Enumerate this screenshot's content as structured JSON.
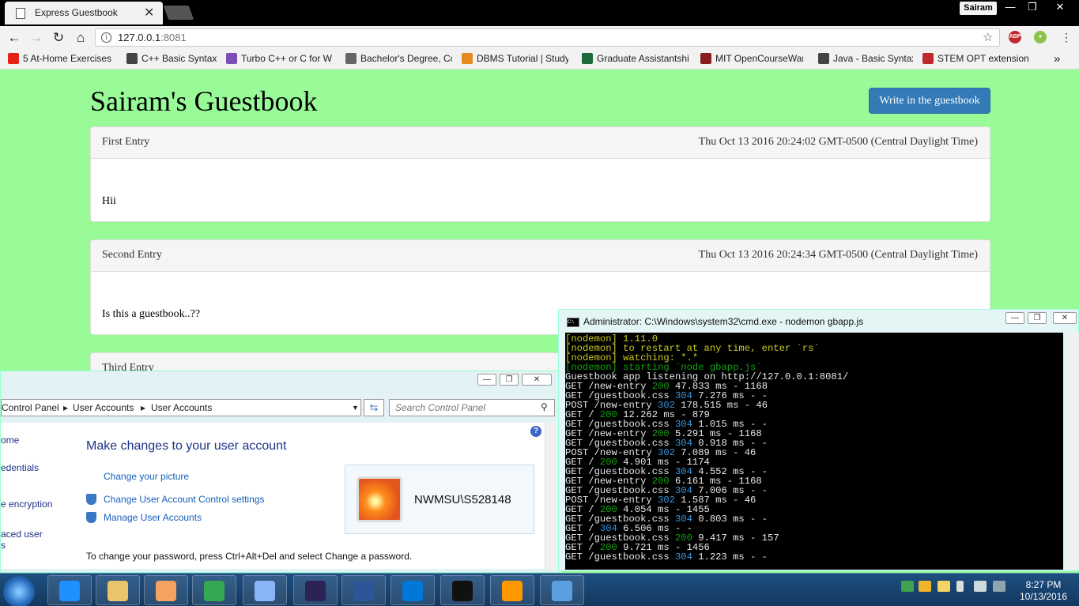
{
  "browser": {
    "tab_title": "Express Guestbook",
    "tab_close": "✕",
    "profile_name": "Sairam",
    "window_controls": [
      "—",
      "❐",
      "✕"
    ],
    "url_host": "127.0.0.1",
    "url_port": ":8081",
    "bookmarks": [
      {
        "label": "5 At-Home Exercises",
        "color": "#e62117"
      },
      {
        "label": "C++ Basic Syntax",
        "color": "#444444"
      },
      {
        "label": "Turbo C++ or C for W",
        "color": "#7a4fb5"
      },
      {
        "label": "Bachelor's Degree, Co",
        "color": "#666666"
      },
      {
        "label": "DBMS Tutorial | Study",
        "color": "#e58a1f"
      },
      {
        "label": "Graduate Assistantshi",
        "color": "#1d6b3a"
      },
      {
        "label": "MIT OpenCourseWare",
        "color": "#8a1c1c"
      },
      {
        "label": "Java - Basic Syntax",
        "color": "#444444"
      },
      {
        "label": "STEM OPT extension",
        "color": "#c0282d"
      }
    ],
    "bookmarks_more": "»",
    "extensions": [
      {
        "label": "ABP",
        "color": "#c1272d"
      },
      {
        "label": "●",
        "color": "#8bc34a"
      }
    ]
  },
  "page": {
    "title": "Sairam's Guestbook",
    "write_button": "Write in the guestbook",
    "entries": [
      {
        "title": "First Entry",
        "date": "Thu Oct 13 2016 20:24:02 GMT-0500 (Central Daylight Time)",
        "body": "Hii"
      },
      {
        "title": "Second Entry",
        "date": "Thu Oct 13 2016 20:24:34 GMT-0500 (Central Daylight Time)",
        "body": "Is this a guestbook..??"
      },
      {
        "title": "Third Entry"
      }
    ]
  },
  "control_panel": {
    "breadcrumb": [
      "Control Panel",
      "User Accounts",
      "User Accounts"
    ],
    "search_placeholder": "Search Control Panel",
    "side_items": [
      "ome",
      "edentials",
      "e encryption",
      "aced user",
      "s"
    ],
    "heading": "Make changes to your user account",
    "links": [
      "Change your picture",
      "Change User Account Control settings",
      "Manage User Accounts"
    ],
    "user_name": "NWMSU\\S528148",
    "footer_text": "To change your password, press Ctrl+Alt+Del and select Change a password."
  },
  "cmd": {
    "title": "Administrator: C:\\Windows\\system32\\cmd.exe - nodemon  gbapp.js",
    "lines": [
      [
        {
          "t": "[nodemon] 1.11.0",
          "c": "y"
        }
      ],
      [
        {
          "t": "[nodemon] to restart at any time, enter `rs`",
          "c": "y"
        }
      ],
      [
        {
          "t": "[nodemon] watching: *.*",
          "c": "y"
        }
      ],
      [
        {
          "t": "[nodemon] starting `node gbapp.js`",
          "c": "gr"
        }
      ],
      [
        {
          "t": "Guestbook app listening on http://127.0.0.1:8081/",
          "c": "w"
        }
      ],
      [
        {
          "t": "GET /new-entry ",
          "c": "w"
        },
        {
          "t": "200",
          "c": "gr"
        },
        {
          "t": " 47.833 ms - 1168",
          "c": "w"
        }
      ],
      [
        {
          "t": "GET /guestbook.css ",
          "c": "w"
        },
        {
          "t": "304",
          "c": "c"
        },
        {
          "t": " 7.276 ms - -",
          "c": "w"
        }
      ],
      [
        {
          "t": "POST /new-entry ",
          "c": "w"
        },
        {
          "t": "302",
          "c": "c"
        },
        {
          "t": " 178.515 ms - 46",
          "c": "w"
        }
      ],
      [
        {
          "t": "GET / ",
          "c": "w"
        },
        {
          "t": "200",
          "c": "gr"
        },
        {
          "t": " 12.262 ms - 879",
          "c": "w"
        }
      ],
      [
        {
          "t": "GET /guestbook.css ",
          "c": "w"
        },
        {
          "t": "304",
          "c": "c"
        },
        {
          "t": " 1.015 ms - -",
          "c": "w"
        }
      ],
      [
        {
          "t": "GET /new-entry ",
          "c": "w"
        },
        {
          "t": "200",
          "c": "gr"
        },
        {
          "t": " 5.291 ms - 1168",
          "c": "w"
        }
      ],
      [
        {
          "t": "GET /guestbook.css ",
          "c": "w"
        },
        {
          "t": "304",
          "c": "c"
        },
        {
          "t": " 0.918 ms - -",
          "c": "w"
        }
      ],
      [
        {
          "t": "POST /new-entry ",
          "c": "w"
        },
        {
          "t": "302",
          "c": "c"
        },
        {
          "t": " 7.089 ms - 46",
          "c": "w"
        }
      ],
      [
        {
          "t": "GET / ",
          "c": "w"
        },
        {
          "t": "200",
          "c": "gr"
        },
        {
          "t": " 4.901 ms - 1174",
          "c": "w"
        }
      ],
      [
        {
          "t": "GET /guestbook.css ",
          "c": "w"
        },
        {
          "t": "304",
          "c": "c"
        },
        {
          "t": " 4.552 ms - -",
          "c": "w"
        }
      ],
      [
        {
          "t": "GET /new-entry ",
          "c": "w"
        },
        {
          "t": "200",
          "c": "gr"
        },
        {
          "t": " 6.161 ms - 1168",
          "c": "w"
        }
      ],
      [
        {
          "t": "GET /guestbook.css ",
          "c": "w"
        },
        {
          "t": "304",
          "c": "c"
        },
        {
          "t": " 7.006 ms - -",
          "c": "w"
        }
      ],
      [
        {
          "t": "POST /new-entry ",
          "c": "w"
        },
        {
          "t": "302",
          "c": "c"
        },
        {
          "t": " 1.587 ms - 46",
          "c": "w"
        }
      ],
      [
        {
          "t": "GET / ",
          "c": "w"
        },
        {
          "t": "200",
          "c": "gr"
        },
        {
          "t": " 4.054 ms - 1455",
          "c": "w"
        }
      ],
      [
        {
          "t": "GET /guestbook.css ",
          "c": "w"
        },
        {
          "t": "304",
          "c": "c"
        },
        {
          "t": " 0.803 ms - -",
          "c": "w"
        }
      ],
      [
        {
          "t": "GET / ",
          "c": "w"
        },
        {
          "t": "304",
          "c": "c"
        },
        {
          "t": " 6.506 ms - -",
          "c": "w"
        }
      ],
      [
        {
          "t": "GET /guestbook.css ",
          "c": "w"
        },
        {
          "t": "200",
          "c": "gr"
        },
        {
          "t": " 9.417 ms - 157",
          "c": "w"
        }
      ],
      [
        {
          "t": "GET / ",
          "c": "w"
        },
        {
          "t": "200",
          "c": "gr"
        },
        {
          "t": " 9.721 ms - 1456",
          "c": "w"
        }
      ],
      [
        {
          "t": "GET /guestbook.css ",
          "c": "w"
        },
        {
          "t": "304",
          "c": "c"
        },
        {
          "t": " 1.223 ms - -",
          "c": "w"
        }
      ]
    ]
  },
  "taskbar": {
    "apps": [
      {
        "name": "ie",
        "color": "#1e90ff"
      },
      {
        "name": "explorer",
        "color": "#e9c46a"
      },
      {
        "name": "media",
        "color": "#f4a261"
      },
      {
        "name": "chrome",
        "color": "#34a853"
      },
      {
        "name": "virtualbox",
        "color": "#8ab4f8"
      },
      {
        "name": "eclipse",
        "color": "#2c2255"
      },
      {
        "name": "word",
        "color": "#2b579a"
      },
      {
        "name": "vscode",
        "color": "#0078d7"
      },
      {
        "name": "cmd",
        "color": "#111111"
      },
      {
        "name": "sublime",
        "color": "#ff9800"
      },
      {
        "name": "control-panel",
        "color": "#5aa0e0"
      }
    ],
    "time": "8:27 PM",
    "date": "10/13/2016"
  }
}
